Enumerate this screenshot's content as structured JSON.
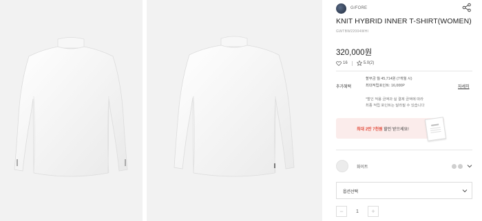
{
  "gallery": {
    "images": [
      {
        "alt": "front view"
      },
      {
        "alt": "back view"
      }
    ]
  },
  "product": {
    "brand": "G/FORE",
    "brand_icon": "brand-logo",
    "title": "KNIT HYBRID INNER T-SHIRT(WOMEN)",
    "code": "GWTBW22004WHI",
    "price": "320,000원",
    "wishlist_count": "16",
    "rating": "5.0(2)"
  },
  "benefits": {
    "label": "추가혜택",
    "lines": [
      "할부금 월 45,714원 (7개월 시)",
      "최대적립포인트: 16,000P"
    ],
    "notes": [
      "*할인 적용 금액과 실 결제 금액에 따라",
      "최종 적립 포인트는 달라질 수 있습니다"
    ],
    "detail_link": "자세히"
  },
  "coupon": {
    "prefix": "최대 2만 7천원",
    "suffix": " 할인 받으세요!"
  },
  "color": {
    "selected_name": "화이트",
    "swatch_colors": [
      "#ececec",
      "#cfcfcf",
      "#cfcfcf"
    ]
  },
  "option": {
    "placeholder": "옵션선택"
  },
  "quantity": {
    "value": "1",
    "minus": "−",
    "plus": "+"
  }
}
